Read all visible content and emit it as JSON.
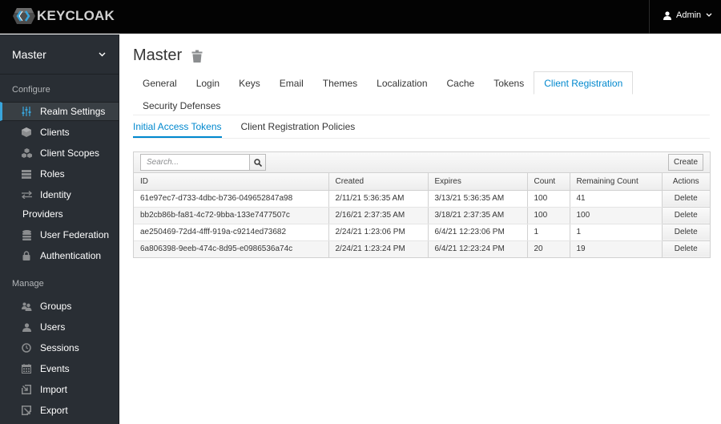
{
  "header": {
    "logo_text": "KEYCLOAK",
    "user_label": "Admin"
  },
  "sidebar": {
    "realm": "Master",
    "configure_label": "Configure",
    "manage_label": "Manage",
    "configure_items": [
      {
        "label": "Realm Settings",
        "icon": "sliders-icon",
        "active": true
      },
      {
        "label": "Clients",
        "icon": "cube-icon"
      },
      {
        "label": "Client Scopes",
        "icon": "cubes-icon"
      },
      {
        "label": "Roles",
        "icon": "list-icon"
      },
      {
        "label": "Identity",
        "icon": "exchange-icon"
      },
      {
        "label": "Providers",
        "icon": ""
      },
      {
        "label": "User Federation",
        "icon": "database-icon"
      },
      {
        "label": "Authentication",
        "icon": "lock-icon"
      }
    ],
    "manage_items": [
      {
        "label": "Groups",
        "icon": "users-icon"
      },
      {
        "label": "Users",
        "icon": "user-icon"
      },
      {
        "label": "Sessions",
        "icon": "clock-icon"
      },
      {
        "label": "Events",
        "icon": "calendar-icon"
      },
      {
        "label": "Import",
        "icon": "import-icon"
      },
      {
        "label": "Export",
        "icon": "export-icon"
      }
    ]
  },
  "main": {
    "title": "Master",
    "tabs": [
      {
        "label": "General"
      },
      {
        "label": "Login"
      },
      {
        "label": "Keys"
      },
      {
        "label": "Email"
      },
      {
        "label": "Themes"
      },
      {
        "label": "Localization"
      },
      {
        "label": "Cache"
      },
      {
        "label": "Tokens"
      },
      {
        "label": "Client Registration",
        "active": true
      },
      {
        "label": "Security Defenses"
      }
    ],
    "subtabs": [
      {
        "label": "Initial Access Tokens",
        "active": true
      },
      {
        "label": "Client Registration Policies"
      }
    ],
    "search_placeholder": "Search...",
    "create_label": "Create",
    "columns": [
      "ID",
      "Created",
      "Expires",
      "Count",
      "Remaining Count",
      "Actions"
    ],
    "rows": [
      {
        "id": "61e97ec7-d733-4dbc-b736-049652847a98",
        "created": "2/11/21 5:36:35 AM",
        "expires": "3/13/21 5:36:35 AM",
        "count": "100",
        "remaining": "41",
        "action": "Delete"
      },
      {
        "id": "bb2cb86b-fa81-4c72-9bba-133e7477507c",
        "created": "2/16/21 2:37:35 AM",
        "expires": "3/18/21 2:37:35 AM",
        "count": "100",
        "remaining": "100",
        "action": "Delete"
      },
      {
        "id": "ae250469-72d4-4fff-919a-c9214ed73682",
        "created": "2/24/21 1:23:06 PM",
        "expires": "6/4/21 12:23:06 PM",
        "count": "1",
        "remaining": "1",
        "action": "Delete"
      },
      {
        "id": "6a806398-9eeb-474c-8d95-e0986536a74c",
        "created": "2/24/21 1:23:24 PM",
        "expires": "6/4/21 12:23:24 PM",
        "count": "20",
        "remaining": "19",
        "action": "Delete"
      }
    ]
  },
  "colors": {
    "accent": "#0088ce",
    "active_marker": "#39a5dc",
    "sidebar_bg": "#292e34",
    "topbar_bg": "#030303"
  }
}
